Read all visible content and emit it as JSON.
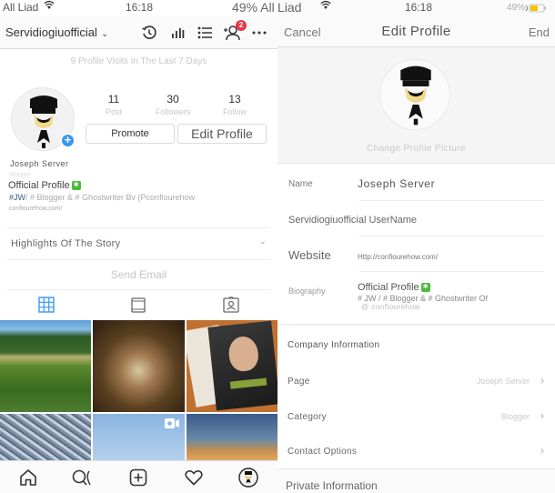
{
  "left": {
    "status": {
      "carrier": "All Liad",
      "time": "16:18",
      "battery": "49% All"
    },
    "header": {
      "account": "Servidiogiuofficial",
      "notification_count": "2",
      "icons": [
        "history-icon",
        "insights-icon",
        "list-icon",
        "discover-people-icon",
        "more-icon"
      ]
    },
    "visits": "9 Profile Visits In The Last 7 Days",
    "profile": {
      "stats": [
        {
          "value": "11",
          "label": "Post"
        },
        {
          "value": "30",
          "label": "Followers"
        },
        {
          "value": "13",
          "label": "Follow"
        }
      ],
      "promote_label": "Promote",
      "edit_label": "Edit Profile",
      "name": "Joseph Server",
      "category": "Blogger",
      "official": "Official Profile",
      "bio_tag": "#JW",
      "bio_rest": "/ # Blogger & # Ghostwriter Bv (Pconfiourehow",
      "url": "confiourehow.com/"
    },
    "highlights": "Highlights Of The Story",
    "send_email": "Send Email",
    "tabs": [
      "grid-tab",
      "feed-tab",
      "tagged-tab"
    ],
    "grid": [
      {
        "subject": "lake-forest",
        "colors": [
          "#5d9fd8",
          "#3b6b2a",
          "#5d8a2c"
        ]
      },
      {
        "subject": "rocks-closeup",
        "colors": [
          "#3a2a1a",
          "#a07850",
          "#d8c8a0"
        ]
      },
      {
        "subject": "book-cover",
        "colors": [
          "#c07030",
          "#2a2a2a",
          "#e8e0d0"
        ]
      },
      {
        "subject": "gravel",
        "colors": [
          "#7a8fa8",
          "#c5d0dc",
          "#5a6a80"
        ]
      },
      {
        "subject": "sky-video",
        "colors": [
          "#8ab4e0",
          "#b4d0ee"
        ]
      },
      {
        "subject": "sunset-clouds",
        "colors": [
          "#4a6a9a",
          "#c89050"
        ]
      }
    ],
    "nav": [
      "home-icon",
      "search-icon",
      "add-post-icon",
      "activity-heart-icon",
      "profile-avatar"
    ]
  },
  "right": {
    "status": {
      "carrier": "Liad",
      "time": "16:18",
      "battery": "49%"
    },
    "header": {
      "cancel": "Cancel",
      "title": "Edit Profile",
      "end": "End"
    },
    "change_picture": "Change Profile Picture",
    "fields": [
      {
        "label": "Name",
        "value": "Joseph Server"
      },
      {
        "label": "Servidiogiuofficial",
        "value": "UserName"
      },
      {
        "label": "Website",
        "value": "Http://confiourehow.com/"
      },
      {
        "label": "Biography",
        "value_line1": "Official Profile",
        "value_line2": "# JW / # Blogger & # Ghostwriter Of",
        "value_line3": "@ confiourehow"
      }
    ],
    "company": {
      "heading": "Company Information",
      "rows": [
        {
          "label": "Page",
          "value": "Joseph Server"
        },
        {
          "label": "Category",
          "value": "Blogger"
        },
        {
          "label": "Contact Options",
          "value": ""
        }
      ]
    },
    "private_heading": "Private Information"
  },
  "colors": {
    "accent_blue": "#3897f0",
    "badge_red": "#e8374a",
    "verified_green": "#4cbb3c",
    "battery_yellow": "#f5c400"
  }
}
